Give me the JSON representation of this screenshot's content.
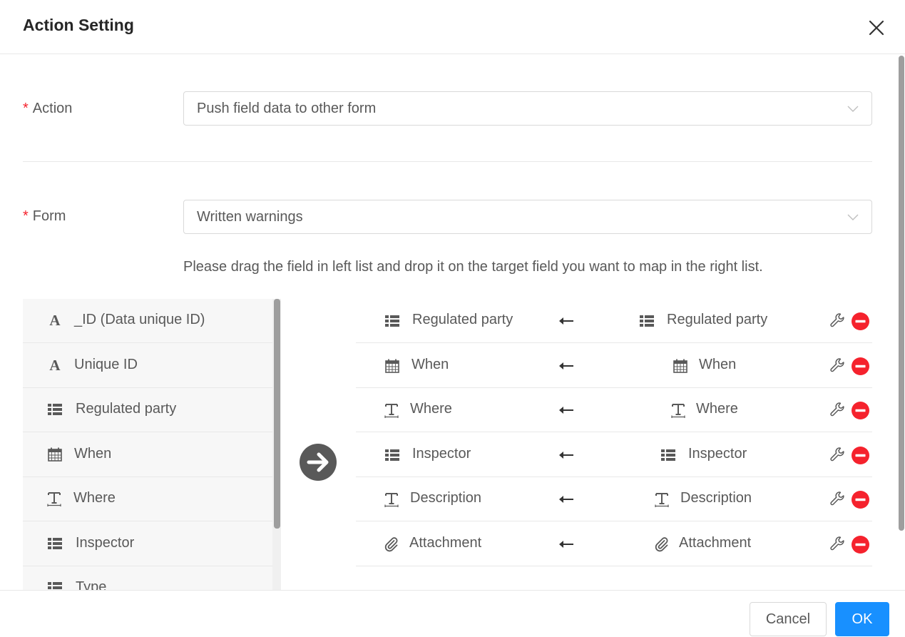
{
  "dialog": {
    "title": "Action Setting",
    "close_icon": "close-icon"
  },
  "action": {
    "label": "Action",
    "required_mark": "*",
    "value": "Push field data to other form"
  },
  "form": {
    "label": "Form",
    "required_mark": "*",
    "value": "Written warnings"
  },
  "hint": "Please drag the field in left list and drop it on the target field you want to map in the right list.",
  "source_fields": [
    {
      "label": "_ID (Data unique ID)",
      "icon": "text-a-icon"
    },
    {
      "label": "Unique ID",
      "icon": "text-a-icon"
    },
    {
      "label": "Regulated party",
      "icon": "list-icon"
    },
    {
      "label": "When",
      "icon": "calendar-icon"
    },
    {
      "label": "Where",
      "icon": "text-t-icon"
    },
    {
      "label": "Inspector",
      "icon": "list-icon"
    },
    {
      "label": "Type",
      "icon": "list-icon"
    }
  ],
  "mappings": [
    {
      "target": "Regulated party",
      "target_icon": "list-icon",
      "source": "Regulated party",
      "source_icon": "list-icon"
    },
    {
      "target": "When",
      "target_icon": "calendar-icon",
      "source": "When",
      "source_icon": "calendar-icon"
    },
    {
      "target": "Where",
      "target_icon": "text-t-icon",
      "source": "Where",
      "source_icon": "text-t-icon"
    },
    {
      "target": "Inspector",
      "target_icon": "list-icon",
      "source": "Inspector",
      "source_icon": "list-icon"
    },
    {
      "target": "Description",
      "target_icon": "text-t-icon",
      "source": "Description",
      "source_icon": "text-t-icon"
    },
    {
      "target": "Attachment",
      "target_icon": "paperclip-icon",
      "source": "Attachment",
      "source_icon": "paperclip-icon"
    }
  ],
  "footer": {
    "cancel_label": "Cancel",
    "ok_label": "OK"
  },
  "colors": {
    "primary": "#1890ff",
    "danger": "#f5222d",
    "remove": "#f5222d",
    "icon": "#595959"
  }
}
